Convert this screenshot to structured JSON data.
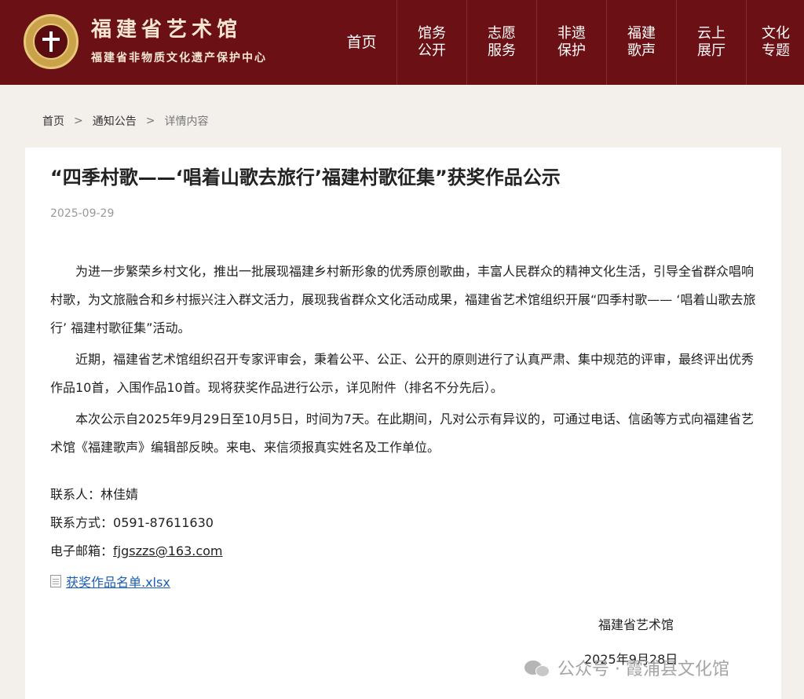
{
  "header": {
    "logo_title": "福建省艺术馆",
    "logo_subtitle": "福建省非物质文化遗产保护中心",
    "nav": [
      {
        "label": "首页"
      },
      {
        "label": "馆务公开"
      },
      {
        "label": "志愿服务"
      },
      {
        "label": "非遗保护"
      },
      {
        "label": "福建歌声"
      },
      {
        "label": "云上展厅"
      },
      {
        "label": "文化专题"
      }
    ]
  },
  "breadcrumb": {
    "home": "首页",
    "section": "通知公告",
    "current": "详情内容",
    "separator": ">"
  },
  "article": {
    "title": "“四季村歌——‘唱着山歌去旅行’福建村歌征集”获奖作品公示",
    "date": "2025-09-29",
    "paragraphs": [
      "为进一步繁荣乡村文化，推出一批展现福建乡村新形象的优秀原创歌曲，丰富人民群众的精神文化生活，引导全省群众唱响村歌，为文旅融合和乡村振兴注入群文活力，展现我省群众文化活动成果，福建省艺术馆组织开展“四季村歌—— ‘唱着山歌去旅行’ 福建村歌征集”活动。",
      "近期，福建省艺术馆组织召开专家评审会，秉着公平、公正、公开的原则进行了认真严肃、集中规范的评审，最终评出优秀作品10首，入围作品10首。现将获奖作品进行公示，详见附件（排名不分先后）。",
      "本次公示自2025年9月29日至10月5日，时间为7天。在此期间，凡对公示有异议的，可通过电话、信函等方式向福建省艺术馆《福建歌声》编辑部反映。来电、来信须报真实姓名及工作单位。"
    ],
    "contact_person_label": "联系人：",
    "contact_person": "林佳婧",
    "contact_phone_label": "联系方式：",
    "contact_phone": "0591-87611630",
    "contact_email_label": "电子邮箱：",
    "contact_email": "fjgszzs@163.com",
    "attachment": "获奖作品名单.xlsx",
    "signature_org": "福建省艺术馆",
    "signature_date": "2025年9月28日"
  },
  "watermark": {
    "text": "公众号 · 霞浦县文化馆",
    "icon": "wechat-icon"
  }
}
